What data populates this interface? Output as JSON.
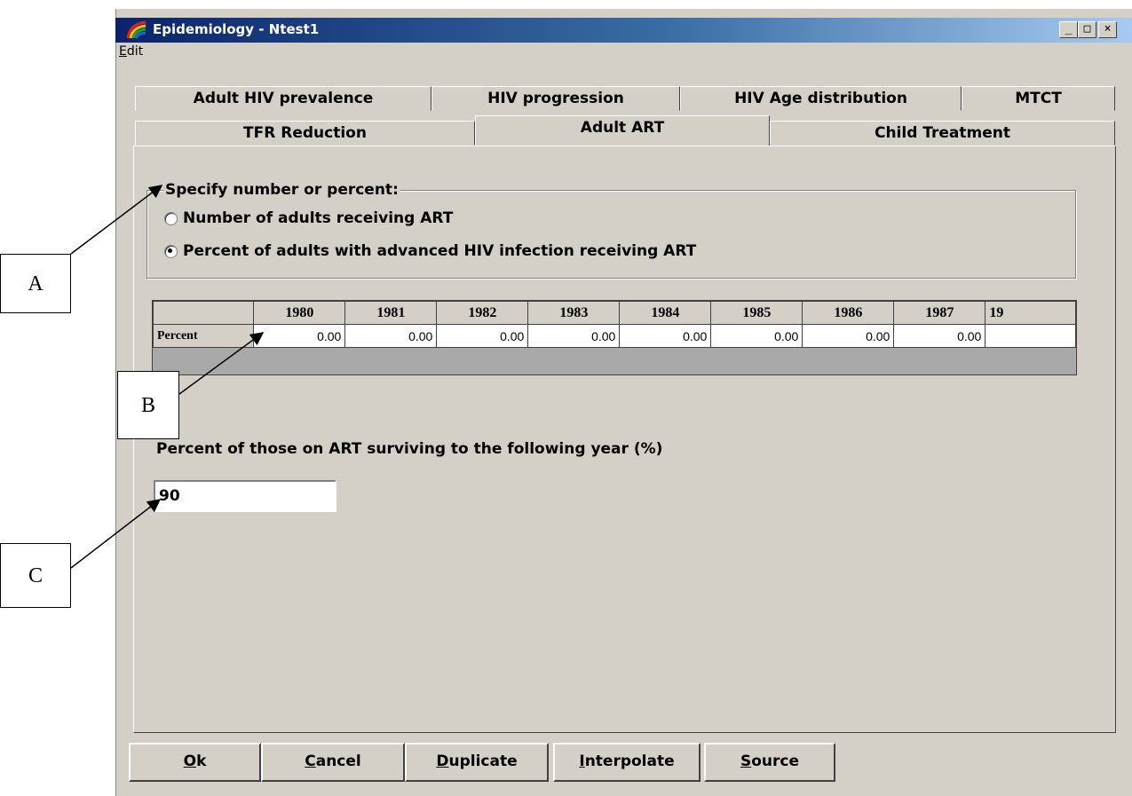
{
  "window": {
    "title": "Epidemiology - Ntest1",
    "minimize_glyph": "_",
    "maximize_glyph": "□",
    "close_glyph": "×"
  },
  "menu": {
    "edit_prefix": "E",
    "edit_rest": "dit"
  },
  "tabs_row1": [
    "Adult HIV prevalence",
    "HIV progression",
    "HIV Age distribution",
    "MTCT"
  ],
  "tabs_row2": [
    "TFR Reduction",
    "Adult ART",
    "Child Treatment"
  ],
  "active_tab": "Adult ART",
  "group": {
    "legend": "Specify number or percent:",
    "option1": "Number of adults receiving ART",
    "option2": "Percent of adults with advanced HIV infection receiving ART",
    "selected": "option2"
  },
  "grid": {
    "years": [
      "1980",
      "1981",
      "1982",
      "1983",
      "1984",
      "1985",
      "1986",
      "1987",
      "19"
    ],
    "row_label": "Percent",
    "values": [
      "0.00",
      "0.00",
      "0.00",
      "0.00",
      "0.00",
      "0.00",
      "0.00",
      "0.00",
      ""
    ]
  },
  "survival": {
    "label": "Percent of those on ART surviving to the following year (%)",
    "value": "90"
  },
  "buttons": {
    "ok": {
      "u": "O",
      "rest": "k"
    },
    "cancel": {
      "u": "C",
      "rest": "ancel"
    },
    "duplicate": {
      "u": "D",
      "rest": "uplicate"
    },
    "interpolate": {
      "u": "I",
      "rest": "nterpolate"
    },
    "source": {
      "u": "S",
      "rest": "ource"
    }
  },
  "callouts": {
    "a": "A",
    "b": "B",
    "c": "C"
  },
  "colors": {
    "title_start": "#0a246a",
    "face": "#d4d0c8",
    "grid_bg": "#a9a9a9"
  }
}
